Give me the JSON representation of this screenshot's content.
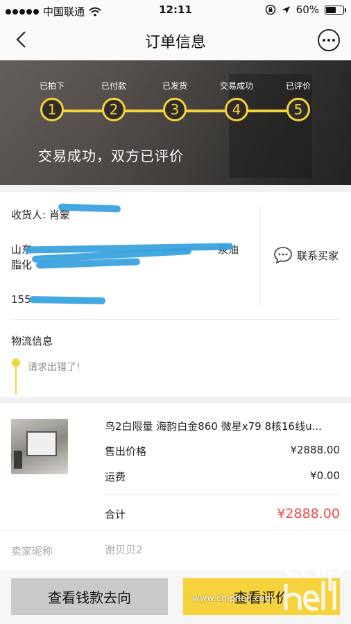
{
  "status_bar": {
    "carrier": "中国联通",
    "time": "12:11",
    "battery": "60%",
    "battery_level": 0.6
  },
  "nav": {
    "title": "订单信息"
  },
  "progress": {
    "steps": [
      {
        "label": "已拍下",
        "number": "1"
      },
      {
        "label": "已付款",
        "number": "2"
      },
      {
        "label": "已发货",
        "number": "3"
      },
      {
        "label": "交易成功",
        "number": "4"
      },
      {
        "label": "已评价",
        "number": "5"
      }
    ],
    "status_text": "交易成功，双方已评价"
  },
  "receiver": {
    "name": "收货人: 肖蒙",
    "address_line1": "山东",
    "address_line1_end": "泉油",
    "address_line2": "脂化",
    "phone_prefix": "155",
    "contact_button": "联系买家"
  },
  "logistics": {
    "title": "物流信息",
    "message": "请求出错了!"
  },
  "product": {
    "title": "鸟2白限量 海韵白金860 微星x79 8核16线u...",
    "sale_price_label": "售出价格",
    "sale_price": "¥2888.00",
    "shipping_label": "运费",
    "shipping": "¥0.00",
    "total_label": "合计",
    "total": "¥2888.00",
    "seller_label": "卖家昵称",
    "seller_name": "谢贝贝2"
  },
  "actions": {
    "view_money": "查看钱款去向",
    "view_review": "查看评价"
  },
  "watermark": {
    "url": "www.chiphell.com"
  },
  "colors": {
    "accent_yellow": "#f6d23c",
    "price_red": "#f14a4a"
  }
}
